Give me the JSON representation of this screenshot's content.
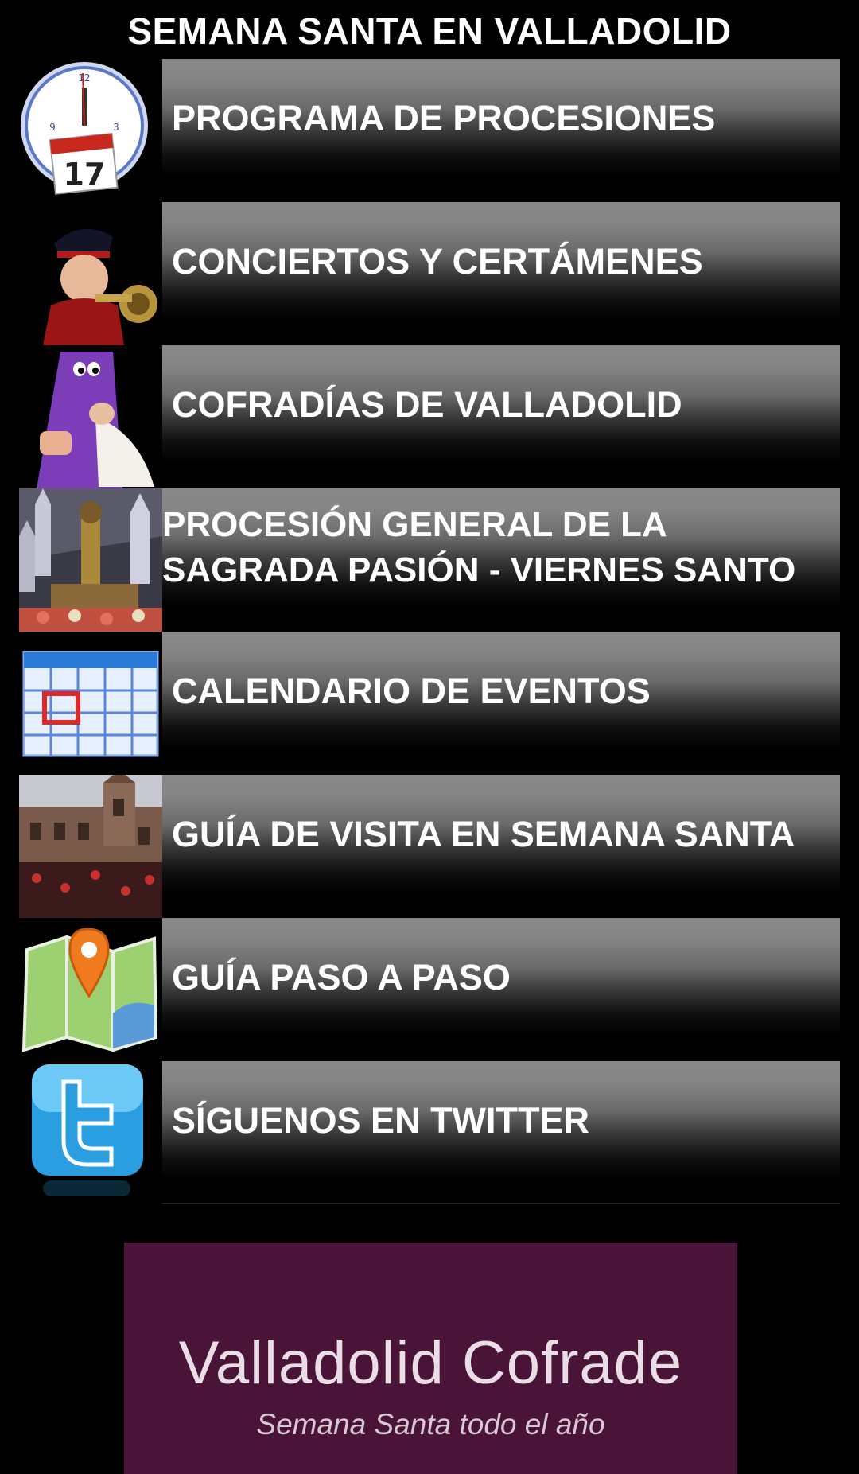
{
  "header": {
    "title": "SEMANA SANTA EN VALLADOLID"
  },
  "menu": {
    "items": [
      {
        "label": "PROGRAMA DE PROCESIONES",
        "icon": "clock-calendar-icon"
      },
      {
        "label": "CONCIERTOS Y CERTÁMENES",
        "icon": "band-musician-icon"
      },
      {
        "label": "COFRADÍAS DE VALLADOLID",
        "icon": "nazareno-figure-icon"
      },
      {
        "label_line1": "PROCESIÓN GENERAL DE LA",
        "label_line2": "SAGRADA PASIÓN - VIERNES SANTO",
        "icon": "procession-photo-icon"
      },
      {
        "label": "CALENDARIO DE EVENTOS",
        "icon": "calendar-grid-icon"
      },
      {
        "label": "GUÍA DE VISITA EN SEMANA SANTA",
        "icon": "building-photo-icon"
      },
      {
        "label": "GUÍA PASO A PASO",
        "icon": "map-pin-icon"
      },
      {
        "label": "SÍGUENOS EN TWITTER",
        "icon": "twitter-icon"
      }
    ]
  },
  "banner": {
    "title": "Valladolid Cofrade",
    "subtitle": "Semana Santa todo el año",
    "color": "#4a1338"
  },
  "colors": {
    "background": "#000000",
    "button_top": "#888888",
    "button_bottom": "#000000"
  }
}
